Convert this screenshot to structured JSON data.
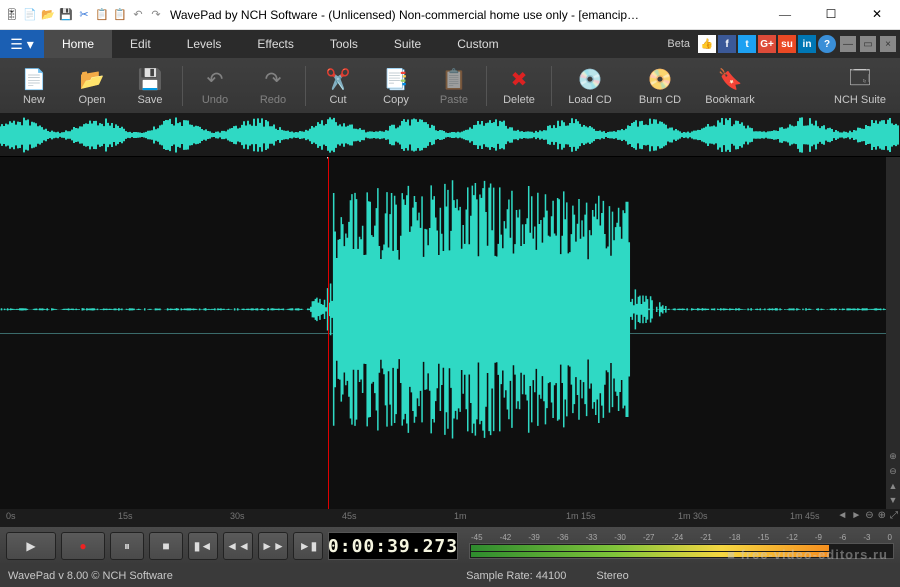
{
  "window": {
    "title": "WavePad by NCH Software - (Unlicensed) Non-commercial home use only - [emancip…"
  },
  "menubar": {
    "tabs": [
      "Home",
      "Edit",
      "Levels",
      "Effects",
      "Tools",
      "Suite",
      "Custom"
    ],
    "active": "Home",
    "beta": "Beta"
  },
  "toolbar": {
    "new": "New",
    "open": "Open",
    "save": "Save",
    "undo": "Undo",
    "redo": "Redo",
    "cut": "Cut",
    "copy": "Copy",
    "paste": "Paste",
    "delete": "Delete",
    "loadcd": "Load CD",
    "burncd": "Burn CD",
    "bookmark": "Bookmark",
    "nchsuite": "NCH Suite"
  },
  "timeline": {
    "ticks": [
      "0s",
      "15s",
      "30s",
      "45s",
      "1m",
      "1m 15s",
      "1m 30s",
      "1m 45s"
    ]
  },
  "transport": {
    "timecode": "0:00:39.273"
  },
  "meter": {
    "labels": [
      "-45",
      "-42",
      "-39",
      "-36",
      "-33",
      "-30",
      "-27",
      "-24",
      "-21",
      "-18",
      "-15",
      "-12",
      "-9",
      "-6",
      "-3",
      "0"
    ]
  },
  "status": {
    "version": "WavePad v 8.00 © NCH Software",
    "samplerate": "Sample Rate: 44100",
    "channels": "Stereo"
  },
  "watermark": "■ free-video-editors.ru"
}
